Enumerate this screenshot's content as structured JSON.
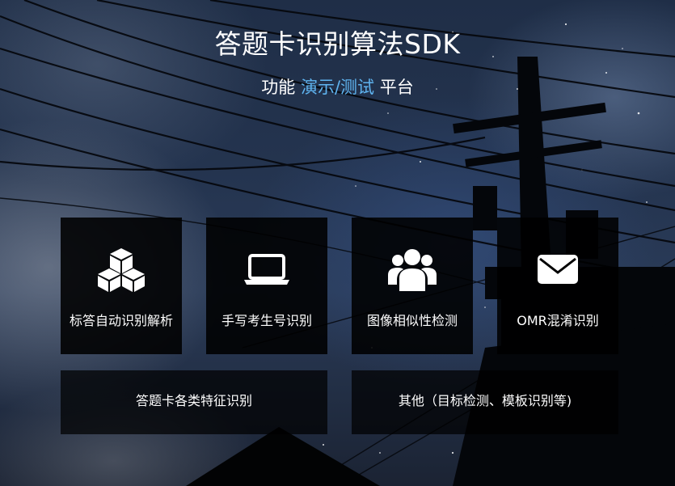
{
  "header": {
    "title": "答题卡识别算法SDK",
    "subtitle_prefix": "功能",
    "subtitle_accent": "演示/测试",
    "subtitle_suffix": "平台"
  },
  "colors": {
    "accent": "#5fb4f0",
    "tile_bg": "#000000",
    "text": "#ffffff"
  },
  "features": [
    {
      "label": "标答自动识别解析",
      "icon": "cubes-icon"
    },
    {
      "label": "手写考生号识别",
      "icon": "laptop-icon"
    },
    {
      "label": "图像相似性检测",
      "icon": "users-icon"
    },
    {
      "label": "OMR混淆识别",
      "icon": "envelope-icon"
    }
  ],
  "wide_features": [
    {
      "label": "答题卡各类特征识别"
    },
    {
      "label": "其他（目标检测、模板识别等)"
    }
  ]
}
